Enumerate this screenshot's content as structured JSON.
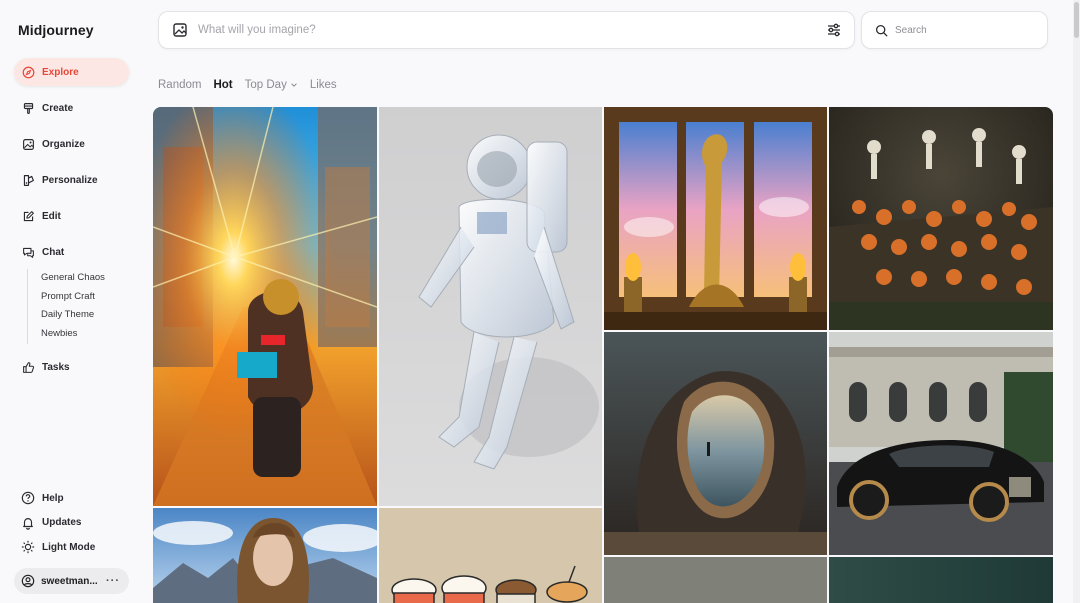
{
  "app": {
    "brand": "Midjourney"
  },
  "sidebar": {
    "items": [
      {
        "label": "Explore",
        "icon": "compass-icon",
        "active": true
      },
      {
        "label": "Create",
        "icon": "brush-icon"
      },
      {
        "label": "Organize",
        "icon": "image-icon"
      },
      {
        "label": "Personalize",
        "icon": "personalize-icon"
      },
      {
        "label": "Edit",
        "icon": "edit-icon"
      },
      {
        "label": "Chat",
        "icon": "chat-icon"
      }
    ],
    "chat_rooms": [
      "General Chaos",
      "Prompt Craft",
      "Daily Theme",
      "Newbies"
    ],
    "tasks": {
      "label": "Tasks",
      "icon": "thumbs-up-icon"
    },
    "bottom": [
      {
        "label": "Help",
        "icon": "help-icon"
      },
      {
        "label": "Updates",
        "icon": "bell-icon"
      },
      {
        "label": "Light Mode",
        "icon": "sun-icon"
      }
    ],
    "user": {
      "name": "sweetman...",
      "more": "···"
    }
  },
  "topbar": {
    "imagine_placeholder": "What will you imagine?",
    "search_placeholder": "Search"
  },
  "tabs": [
    {
      "label": "Random",
      "active": false
    },
    {
      "label": "Hot",
      "active": true
    },
    {
      "label": "Top Day",
      "active": false,
      "dropdown": true
    },
    {
      "label": "Likes",
      "active": false
    }
  ],
  "gallery": {
    "images": [
      {
        "subject": "motorcycle rider in neon city with sunburst"
      },
      {
        "subject": "transparent crystal astronaut"
      },
      {
        "subject": "golden dragon between window arches"
      },
      {
        "subject": "skeletons with pumpkins"
      },
      {
        "subject": "head-shaped rock with seascape portal"
      },
      {
        "subject": "black luxury car in front of mansion"
      },
      {
        "subject": "woman portrait with mountains"
      },
      {
        "subject": "cartoon cupcakes"
      },
      {
        "subject": "grey stone texture"
      },
      {
        "subject": "dark green water"
      }
    ]
  },
  "colors": {
    "accent": "#e5483a",
    "active_bg": "#fde7e4"
  }
}
